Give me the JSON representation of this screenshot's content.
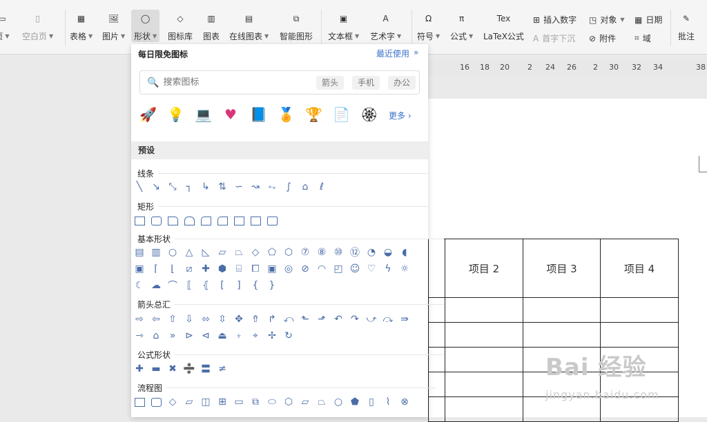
{
  "toolbar": {
    "items": [
      {
        "label": "页",
        "icon": "page-break-icon",
        "caret": true
      },
      {
        "label": "空白页",
        "icon": "blank-page-icon",
        "caret": true,
        "disabled": true
      },
      {
        "label": "表格",
        "icon": "table-icon",
        "caret": true
      },
      {
        "label": "图片",
        "icon": "image-icon",
        "caret": true
      },
      {
        "label": "形状",
        "icon": "shape-icon",
        "caret": true,
        "active": true
      },
      {
        "label": "图标库",
        "icon": "icon-library-icon"
      },
      {
        "label": "图表",
        "icon": "chart-icon"
      },
      {
        "label": "在线图表",
        "icon": "online-chart-icon",
        "caret": true
      },
      {
        "label": "智能图形",
        "icon": "smart-graphic-icon"
      },
      {
        "label": "文本框",
        "icon": "textbox-icon",
        "caret": true
      },
      {
        "label": "艺术字",
        "icon": "wordart-icon",
        "caret": true
      },
      {
        "label": "符号",
        "icon": "omega-icon",
        "caret": true
      },
      {
        "label": "公式",
        "icon": "pi-icon",
        "caret": true
      },
      {
        "label": "LaTeX公式",
        "icon": "latex-icon"
      },
      {
        "label": "批注",
        "icon": "comment-icon"
      }
    ],
    "small_items": [
      {
        "label": "插入数字",
        "icon": "insert-number-icon"
      },
      {
        "label": "首字下沉",
        "icon": "drop-cap-icon",
        "disabled": true
      },
      {
        "label": "对象",
        "icon": "object-icon",
        "caret": true
      },
      {
        "label": "附件",
        "icon": "attachment-icon"
      },
      {
        "label": "日期",
        "icon": "calendar-icon"
      },
      {
        "label": "域",
        "icon": "field-icon"
      }
    ]
  },
  "ruler": {
    "marks": [
      "16",
      "18",
      "20",
      "2",
      "24",
      "26",
      "2",
      "30",
      "32",
      "34",
      "38"
    ]
  },
  "doc_table": {
    "headers": [
      "",
      "项目 2",
      "项目 3",
      "项目 4"
    ],
    "empty_rows": 5
  },
  "watermark": {
    "main": "Bai 经验",
    "sub": "jingyan.baidu.com"
  },
  "panel": {
    "title": "每日限免图标",
    "recent": "最近使用",
    "search_placeholder": "搜索图标",
    "tags": [
      "箭头",
      "手机",
      "办公"
    ],
    "free_icons": [
      "rocket-icon",
      "lightbulb-icon",
      "laptop-chart-icon",
      "heart-pulse-icon",
      "book-icon",
      "medal-icon",
      "trophy-icon",
      "document-icon",
      "badge-icon"
    ],
    "more": "更多",
    "preset": "预设",
    "sections": [
      "线条",
      "矩形",
      "基本形状",
      "箭头总汇",
      "公式形状",
      "流程图"
    ]
  },
  "colors": {
    "accent": "#3b72c8",
    "shape_stroke": "#4a6da8"
  }
}
